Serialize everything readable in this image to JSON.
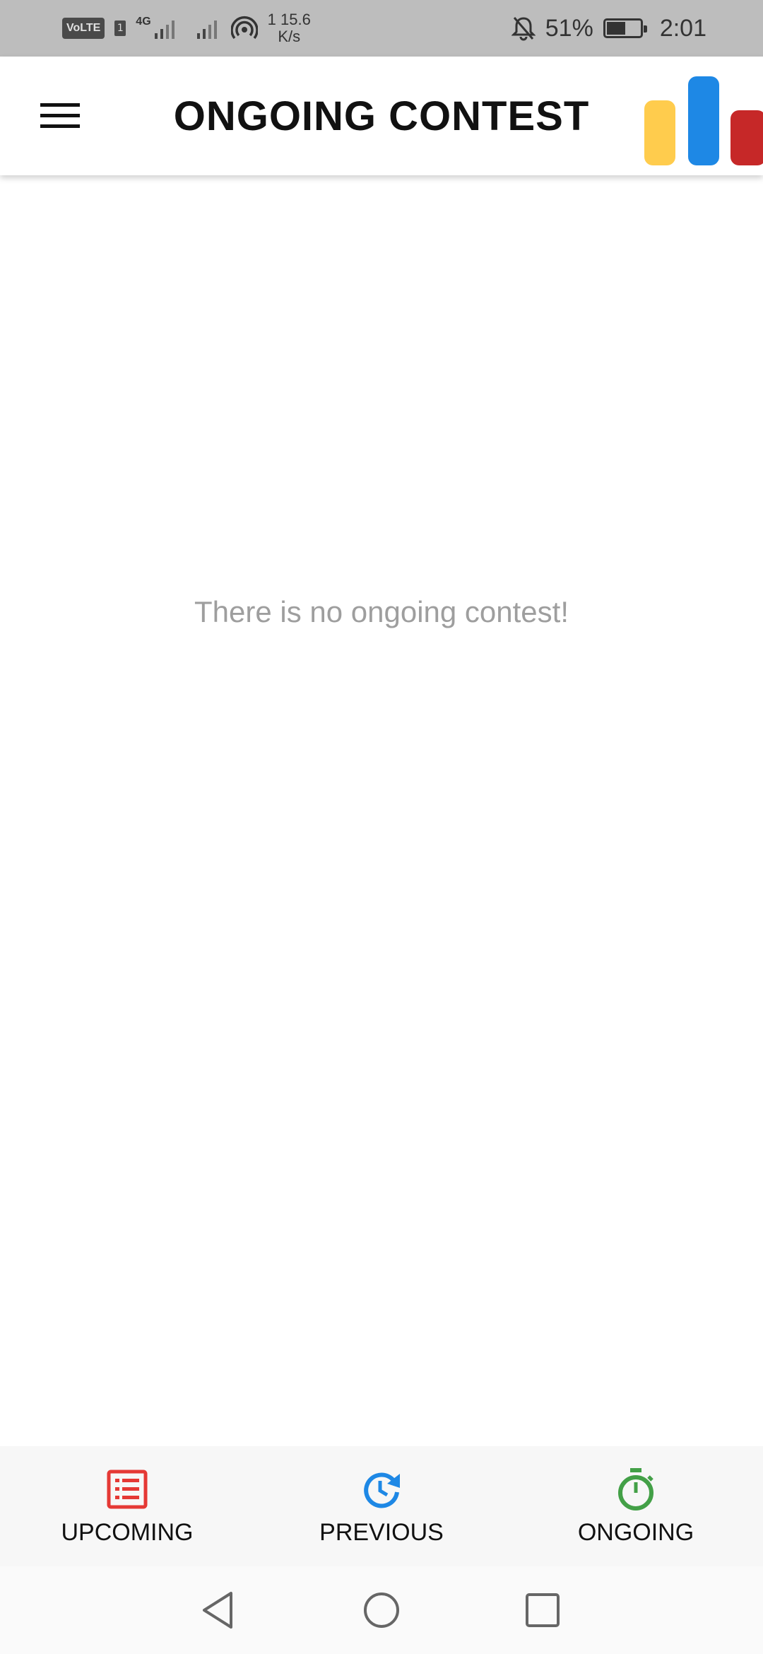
{
  "status_bar": {
    "volte_label": "VoLTE",
    "sim_label": "1",
    "network_label": "4G",
    "speed_top": "1 15.6",
    "speed_bottom": "K/s",
    "battery_percent": "51%",
    "time": "2:01"
  },
  "app_bar": {
    "title": "ONGOING CONTEST",
    "logo_colors": [
      "#FFCC4D",
      "#1E88E5",
      "#C62828"
    ]
  },
  "main": {
    "empty_message": "There is no ongoing contest!"
  },
  "bottom_nav": {
    "items": [
      {
        "label": "UPCOMING",
        "icon": "list-icon",
        "color": "#E53935"
      },
      {
        "label": "PREVIOUS",
        "icon": "history-icon",
        "color": "#1E88E5"
      },
      {
        "label": "ONGOING",
        "icon": "stopwatch-icon",
        "color": "#43A047"
      }
    ]
  },
  "system_nav": {
    "buttons": [
      "back-icon",
      "home-icon",
      "recents-icon"
    ]
  }
}
